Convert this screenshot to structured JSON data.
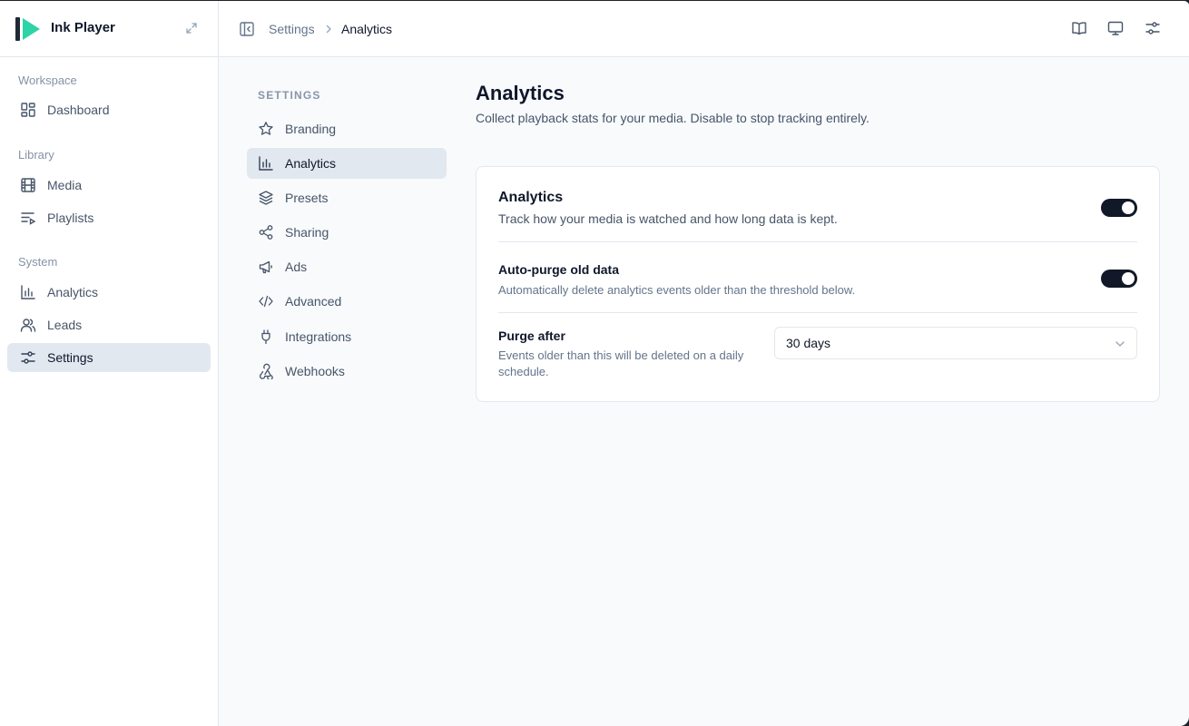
{
  "app": {
    "name": "Ink Player"
  },
  "colors": {
    "logo_bar": "#1f2937",
    "logo_play": "#2dd4a7",
    "toggle_on": "#111827"
  },
  "sidebar": {
    "groups": [
      {
        "label": "Workspace",
        "items": [
          {
            "label": "Dashboard",
            "icon": "dashboard-icon"
          }
        ]
      },
      {
        "label": "Library",
        "items": [
          {
            "label": "Media",
            "icon": "film-icon"
          },
          {
            "label": "Playlists",
            "icon": "playlist-icon"
          }
        ]
      },
      {
        "label": "System",
        "items": [
          {
            "label": "Analytics",
            "icon": "bar-chart-icon"
          },
          {
            "label": "Leads",
            "icon": "users-icon"
          },
          {
            "label": "Settings",
            "icon": "sliders-icon",
            "active": true
          }
        ]
      }
    ]
  },
  "breadcrumb": {
    "root": "Settings",
    "current": "Analytics"
  },
  "header_icons": [
    "book-icon",
    "monitor-icon",
    "sliders-icon"
  ],
  "settings_nav": {
    "title": "SETTINGS",
    "items": [
      {
        "label": "Branding",
        "icon": "star-icon"
      },
      {
        "label": "Analytics",
        "icon": "bar-chart-icon",
        "active": true
      },
      {
        "label": "Presets",
        "icon": "layers-icon"
      },
      {
        "label": "Sharing",
        "icon": "share-icon"
      },
      {
        "label": "Ads",
        "icon": "megaphone-icon"
      },
      {
        "label": "Advanced",
        "icon": "code-icon"
      },
      {
        "label": "Integrations",
        "icon": "plug-icon"
      },
      {
        "label": "Webhooks",
        "icon": "webhook-icon"
      }
    ]
  },
  "page": {
    "title": "Analytics",
    "subtitle": "Collect playback stats for your media. Disable to stop tracking entirely."
  },
  "card": {
    "analytics": {
      "title": "Analytics",
      "description": "Track how your media is watched and how long data is kept.",
      "enabled": true
    },
    "auto_purge": {
      "title": "Auto-purge old data",
      "description": "Automatically delete analytics events older than the threshold below.",
      "enabled": true
    },
    "purge_after": {
      "title": "Purge after",
      "description_line1": "Events older than this will be deleted on a daily",
      "description_line2": "schedule.",
      "value": "30 days"
    }
  }
}
